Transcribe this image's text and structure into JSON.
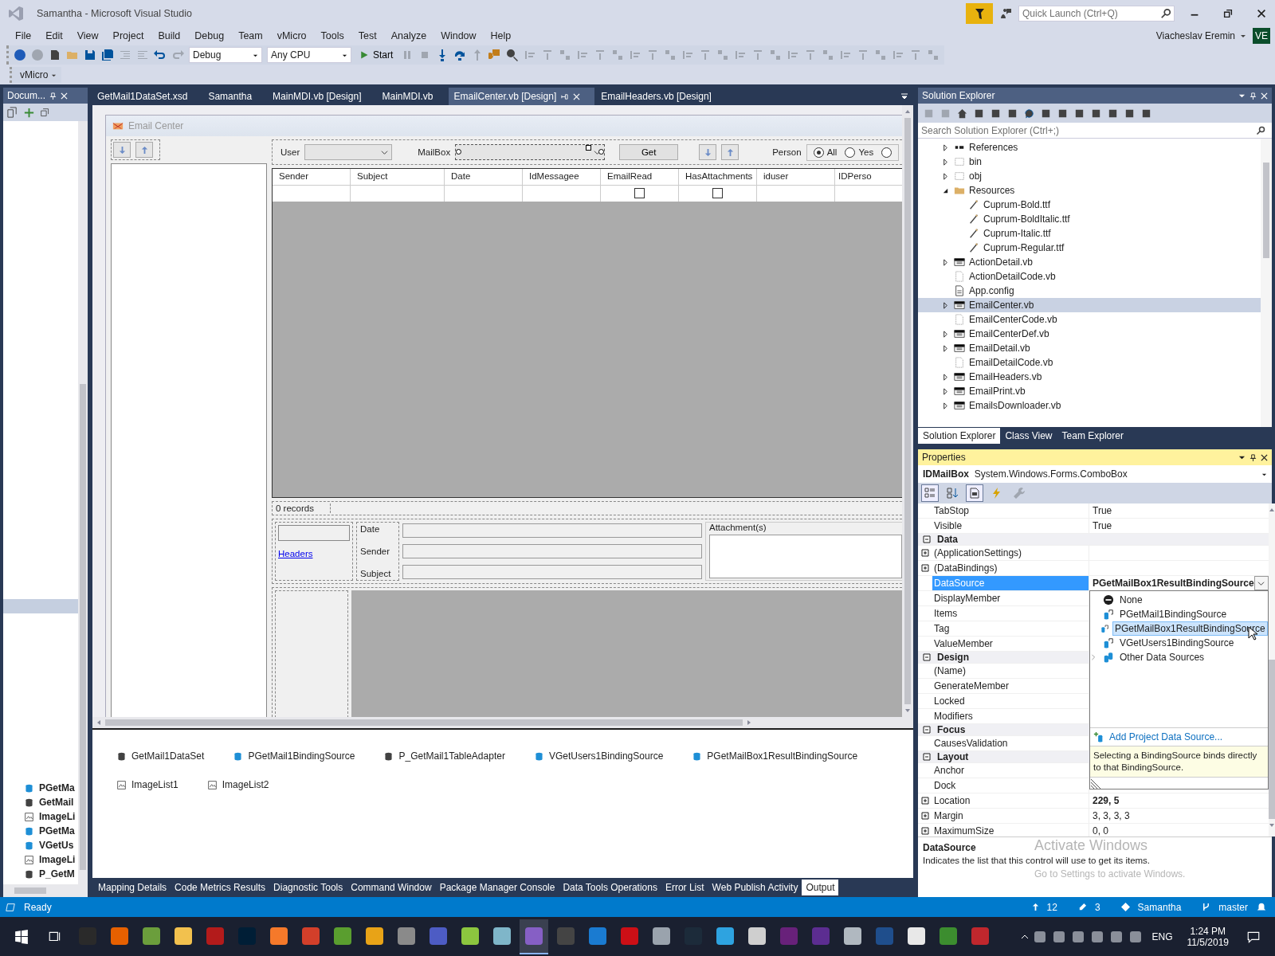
{
  "window": {
    "title": "Samantha - Microsoft Visual Studio",
    "quick_launch": {
      "placeholder": "Quick Launch (Ctrl+Q)"
    },
    "user": "Viacheslav Eremin",
    "avatar": "VE"
  },
  "menu": [
    "File",
    "Edit",
    "View",
    "Project",
    "Build",
    "Debug",
    "Team",
    "vMicro",
    "Tools",
    "Test",
    "Analyze",
    "Window",
    "Help"
  ],
  "toolbar": {
    "configuration": "Debug",
    "platform": "Any CPU",
    "start": "Start",
    "vmicro": "vMicro"
  },
  "document_outline": {
    "title": "Docum...",
    "items": [
      {
        "label": "PGetMa",
        "kind": "binding"
      },
      {
        "label": "GetMail",
        "kind": "dataset"
      },
      {
        "label": "ImageLi",
        "kind": "imagelist"
      },
      {
        "label": "PGetMa",
        "kind": "binding"
      },
      {
        "label": "VGetUs",
        "kind": "binding"
      },
      {
        "label": "ImageLi",
        "kind": "imagelist"
      },
      {
        "label": "P_GetM",
        "kind": "adapter"
      }
    ]
  },
  "document_tabs": [
    {
      "label": "GetMail1DataSet.xsd",
      "selected": false
    },
    {
      "label": "Samantha",
      "selected": false
    },
    {
      "label": "MainMDI.vb [Design]",
      "selected": false
    },
    {
      "label": "MainMDI.vb",
      "selected": false
    },
    {
      "label": "EmailCenter.vb [Design]",
      "selected": true
    },
    {
      "label": "EmailHeaders.vb [Design]",
      "selected": false
    }
  ],
  "form": {
    "title": "Email Center",
    "user_label": "User",
    "mailbox_label": "MailBox",
    "get_button": "Get",
    "person_label": "Person",
    "radios": [
      {
        "label": "All",
        "selected": true
      },
      {
        "label": "Yes",
        "selected": false
      },
      {
        "selected": false
      }
    ],
    "columns": [
      "Sender",
      "Subject",
      "Date",
      "IdMessagee",
      "EmailRead",
      "HasAttachments",
      "iduser",
      "IDPerso"
    ],
    "row": [
      {
        "kind": "text"
      },
      {
        "kind": "text"
      },
      {
        "kind": "text"
      },
      {
        "kind": "text"
      },
      {
        "kind": "checkbox",
        "checked": false
      },
      {
        "kind": "checkbox",
        "checked": false
      },
      {
        "kind": "text"
      },
      {
        "kind": "text"
      }
    ],
    "records": "0 records",
    "headers_link": "Headers",
    "detail_labels": [
      "Date",
      "Sender",
      "Subject"
    ],
    "attachments_label": "Attachment(s)"
  },
  "component_tray": [
    {
      "label": "GetMail1DataSet",
      "kind": "dataset"
    },
    {
      "label": "PGetMail1BindingSource",
      "kind": "binding"
    },
    {
      "label": "P_GetMail1TableAdapter",
      "kind": "adapter"
    },
    {
      "label": "VGetUsers1BindingSource",
      "kind": "binding"
    },
    {
      "label": "PGetMailBox1ResultBindingSource",
      "kind": "binding"
    },
    {
      "label": "ImageList1",
      "kind": "imagelist"
    },
    {
      "label": "ImageList2",
      "kind": "imagelist"
    }
  ],
  "output_tabs": [
    {
      "label": "Mapping Details",
      "selected": false
    },
    {
      "label": "Code Metrics Results",
      "selected": false
    },
    {
      "label": "Diagnostic Tools",
      "selected": false
    },
    {
      "label": "Command Window",
      "selected": false
    },
    {
      "label": "Package Manager Console",
      "selected": false
    },
    {
      "label": "Data Tools Operations",
      "selected": false
    },
    {
      "label": "Error List",
      "selected": false
    },
    {
      "label": "Web Publish Activity",
      "selected": false
    },
    {
      "label": "Output",
      "selected": true
    }
  ],
  "solution_explorer": {
    "title": "Solution Explorer",
    "search": {
      "placeholder": "Search Solution Explorer (Ctrl+;)"
    },
    "tree": [
      {
        "label": "References",
        "kind": "references",
        "expandable": true,
        "expanded": false,
        "selected": false
      },
      {
        "label": "bin",
        "kind": "folder-dotted",
        "expandable": true,
        "expanded": false,
        "selected": false
      },
      {
        "label": "obj",
        "kind": "folder-dotted",
        "expandable": true,
        "expanded": false,
        "selected": false
      },
      {
        "label": "Resources",
        "kind": "folder",
        "expandable": true,
        "expanded": true,
        "selected": false,
        "children": [
          {
            "label": "Cuprum-Bold.ttf",
            "kind": "font",
            "expandable": false,
            "selected": false
          },
          {
            "label": "Cuprum-BoldItalic.ttf",
            "kind": "font",
            "expandable": false,
            "selected": false
          },
          {
            "label": "Cuprum-Italic.ttf",
            "kind": "font",
            "expandable": false,
            "selected": false
          },
          {
            "label": "Cuprum-Regular.ttf",
            "kind": "font",
            "expandable": false,
            "selected": false
          }
        ]
      },
      {
        "label": "ActionDetail.vb",
        "kind": "form",
        "expandable": true,
        "expanded": false,
        "selected": false
      },
      {
        "label": "ActionDetailCode.vb",
        "kind": "code",
        "expandable": false,
        "selected": false
      },
      {
        "label": "App.config",
        "kind": "config",
        "expandable": false,
        "selected": false
      },
      {
        "label": "EmailCenter.vb",
        "kind": "form",
        "expandable": true,
        "expanded": false,
        "selected": true
      },
      {
        "label": "EmailCenterCode.vb",
        "kind": "code",
        "expandable": false,
        "selected": false
      },
      {
        "label": "EmailCenterDef.vb",
        "kind": "form",
        "expandable": true,
        "expanded": false,
        "selected": false
      },
      {
        "label": "EmailDetail.vb",
        "kind": "form",
        "expandable": true,
        "expanded": false,
        "selected": false
      },
      {
        "label": "EmailDetailCode.vb",
        "kind": "code",
        "expandable": false,
        "selected": false
      },
      {
        "label": "EmailHeaders.vb",
        "kind": "form",
        "expandable": true,
        "expanded": false,
        "selected": false
      },
      {
        "label": "EmailPrint.vb",
        "kind": "form",
        "expandable": true,
        "expanded": false,
        "selected": false
      },
      {
        "label": "EmailsDownloader.vb",
        "kind": "form",
        "expandable": true,
        "expanded": false,
        "selected": false
      }
    ],
    "tabs": [
      {
        "label": "Solution Explorer",
        "selected": true
      },
      {
        "label": "Class View",
        "selected": false
      },
      {
        "label": "Team Explorer",
        "selected": false
      }
    ]
  },
  "properties": {
    "title": "Properties",
    "object_name": "IDMailBox",
    "object_type": "System.Windows.Forms.ComboBox",
    "rows": [
      {
        "kind": "property",
        "name": "TabStop",
        "value": "True",
        "expandable": false,
        "selected": false,
        "bold": false
      },
      {
        "kind": "property",
        "name": "Visible",
        "value": "True",
        "expandable": false,
        "selected": false,
        "bold": false
      },
      {
        "kind": "category",
        "name": "Data"
      },
      {
        "kind": "property",
        "name": "(ApplicationSettings)",
        "expandable": true,
        "selected": false
      },
      {
        "kind": "property",
        "name": "(DataBindings)",
        "expandable": true,
        "selected": false
      },
      {
        "kind": "property",
        "name": "DataSource",
        "value": "PGetMailBox1ResultBindingSource",
        "expandable": false,
        "selected": true,
        "bold": true
      },
      {
        "kind": "property",
        "name": "DisplayMember",
        "expandable": false,
        "selected": false
      },
      {
        "kind": "property",
        "name": "Items",
        "expandable": false,
        "selected": false
      },
      {
        "kind": "property",
        "name": "Tag",
        "expandable": false,
        "selected": false
      },
      {
        "kind": "property",
        "name": "ValueMember",
        "expandable": false,
        "selected": false
      },
      {
        "kind": "category",
        "name": "Design"
      },
      {
        "kind": "property",
        "name": "(Name)",
        "expandable": false,
        "selected": false
      },
      {
        "kind": "property",
        "name": "GenerateMember",
        "expandable": false,
        "selected": false
      },
      {
        "kind": "property",
        "name": "Locked",
        "expandable": false,
        "selected": false
      },
      {
        "kind": "property",
        "name": "Modifiers",
        "expandable": false,
        "selected": false
      },
      {
        "kind": "category",
        "name": "Focus"
      },
      {
        "kind": "property",
        "name": "CausesValidation",
        "expandable": false,
        "selected": false
      },
      {
        "kind": "category",
        "name": "Layout"
      },
      {
        "kind": "property",
        "name": "Anchor",
        "expandable": false,
        "selected": false
      },
      {
        "kind": "property",
        "name": "Dock",
        "expandable": false,
        "selected": false
      },
      {
        "kind": "property",
        "name": "Location",
        "value": "229, 5",
        "expandable": true,
        "selected": false,
        "bold": true
      },
      {
        "kind": "property",
        "name": "Margin",
        "value": "3, 3, 3, 3",
        "expandable": true,
        "selected": false,
        "bold": false
      },
      {
        "kind": "property",
        "name": "MaximumSize",
        "value": "0, 0",
        "expandable": true,
        "selected": false,
        "bold": false
      }
    ],
    "dropdown": {
      "options": [
        {
          "label": "None",
          "kind": "none",
          "selected": false
        },
        {
          "label": "PGetMail1BindingSource",
          "kind": "binding",
          "selected": false
        },
        {
          "label": "PGetMailBox1ResultBindingSource",
          "kind": "binding",
          "selected": true
        },
        {
          "label": "VGetUsers1BindingSource",
          "kind": "binding",
          "selected": false
        },
        {
          "label": "Other Data Sources",
          "kind": "group",
          "selected": false
        }
      ],
      "add_link": "Add Project Data Source...",
      "hint": "Selecting a BindingSource binds directly to that BindingSource."
    },
    "description_title": "DataSource",
    "description": "Indicates the list that this control will use to get its items."
  },
  "status_bar": {
    "text": "Ready",
    "pushes": "12",
    "changes": "3",
    "repository": "Samantha",
    "branch": "master"
  },
  "taskbar": {
    "apps": [
      {
        "color": "#2a2a2a",
        "selected": false
      },
      {
        "color": "#e66000",
        "selected": false
      },
      {
        "color": "#6b9e3c",
        "selected": false
      },
      {
        "color": "#f2c14e",
        "selected": false
      },
      {
        "color": "#b31b1b",
        "selected": false
      },
      {
        "color": "#001e36",
        "selected": false
      },
      {
        "color": "#f5792a",
        "selected": false
      },
      {
        "color": "#d23f2a",
        "selected": false
      },
      {
        "color": "#5a9e2f",
        "selected": false
      },
      {
        "color": "#e8a317",
        "selected": false
      },
      {
        "color": "#8a8a8a",
        "selected": false
      },
      {
        "color": "#4d5cc4",
        "selected": false
      },
      {
        "color": "#8cc63f",
        "selected": false
      },
      {
        "color": "#7fb6c9",
        "selected": false
      },
      {
        "color": "#865fc5",
        "selected": true
      },
      {
        "color": "#444444",
        "selected": false
      },
      {
        "color": "#1a7bd1",
        "selected": false
      },
      {
        "color": "#cc0f16",
        "selected": false
      },
      {
        "color": "#9aa3ad",
        "selected": false
      },
      {
        "color": "#1c2b3a",
        "selected": false
      },
      {
        "color": "#2ea3e0",
        "selected": false
      },
      {
        "color": "#cfcfcf",
        "selected": false
      },
      {
        "color": "#68217a",
        "selected": false
      },
      {
        "color": "#5c2d91",
        "selected": false
      },
      {
        "color": "#b0b8c0",
        "selected": false
      },
      {
        "color": "#1f4e8c",
        "selected": false
      },
      {
        "color": "#e8e8e8",
        "selected": false
      },
      {
        "color": "#3c8d2f",
        "selected": false
      },
      {
        "color": "#c0272d",
        "selected": false
      }
    ],
    "language": "ENG",
    "time": "1:24 PM",
    "date": "11/5/2019"
  },
  "watermark": {
    "title": "Activate Windows",
    "subtitle": "Go to Settings to activate Windows."
  }
}
